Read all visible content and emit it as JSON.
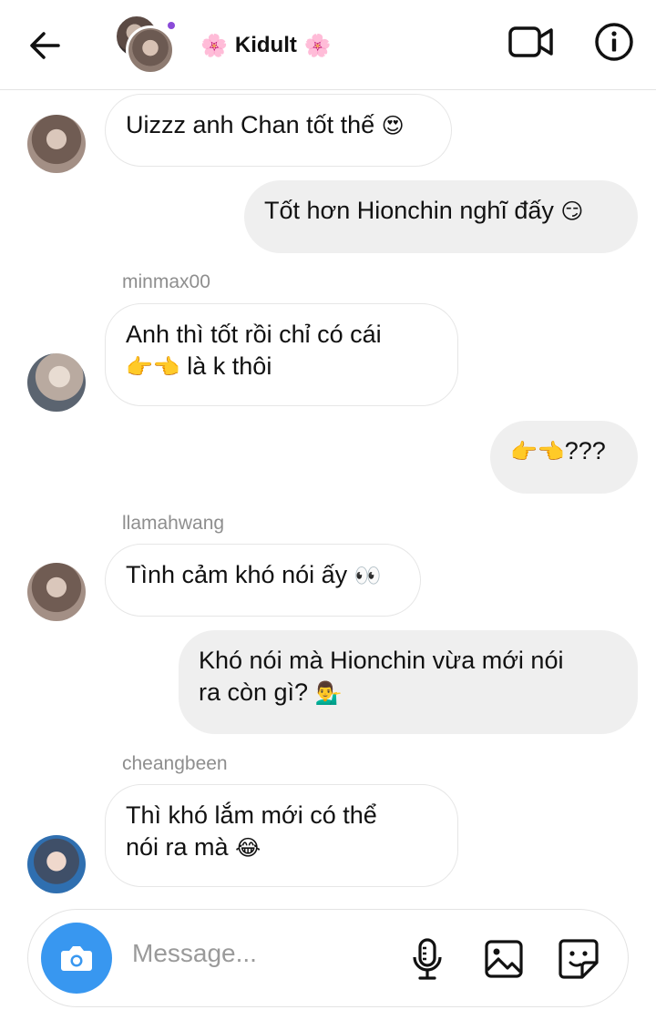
{
  "header": {
    "title": "Kidult",
    "title_emoji": "🌸"
  },
  "messages": [
    {
      "text": "Uizzz anh Chan tốt thế",
      "emoji": "😍"
    },
    {
      "text": "Tốt hơn Hionchin nghĩ đấy",
      "emoji": "😏"
    },
    {
      "sender": "minmax00",
      "line1": "Anh thì tốt rồi chỉ có cái",
      "line2_emoji": "👉👈",
      "line2": " là k thôi"
    },
    {
      "emoji": "👉👈",
      "text": "???"
    },
    {
      "sender": "llamahwang",
      "text": "Tình cảm khó nói ấy",
      "emoji": "👀"
    },
    {
      "line1": "Khó nói mà Hionchin vừa mới nói",
      "line2": "ra còn gì? ",
      "emoji": "💁‍♂️"
    },
    {
      "sender": "cheangbeen",
      "line1": "Thì khó lắm mới có thể",
      "line2": "nói ra mà ",
      "emoji": "😂"
    }
  ],
  "composer": {
    "placeholder": "Message..."
  },
  "colors": {
    "camera_button": "#3897f0",
    "outgoing_bubble": "#efefef",
    "incoming_border": "#e6e6e6",
    "sender_label": "#8e8e8e"
  },
  "icons": [
    "back-arrow-icon",
    "video-call-icon",
    "info-icon",
    "camera-icon",
    "microphone-icon",
    "gallery-icon",
    "sticker-icon"
  ]
}
